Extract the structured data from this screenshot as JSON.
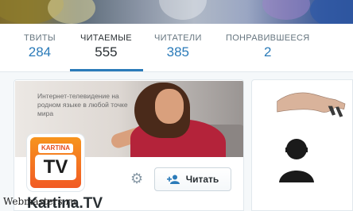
{
  "stats": [
    {
      "label": "ТВИТЫ",
      "value": "284"
    },
    {
      "label": "ЧИТАЕМЫЕ",
      "value": "555"
    },
    {
      "label": "ЧИТАТЕЛИ",
      "value": "385"
    },
    {
      "label": "ПОНРАВИВШЕЕСЯ",
      "value": "2"
    }
  ],
  "active_tab_index": 1,
  "card": {
    "promo_text": "Интернет-телевидение на родном языке в любой точке мира",
    "logo_top": "KARTINA",
    "logo_main": "TV",
    "follow_label": "Читать",
    "name": "Kartina.TV"
  },
  "watermark": "Webmasters.ru",
  "colors": {
    "accent": "#2b7bb9",
    "text": "#292f33",
    "muted": "#66757f"
  }
}
